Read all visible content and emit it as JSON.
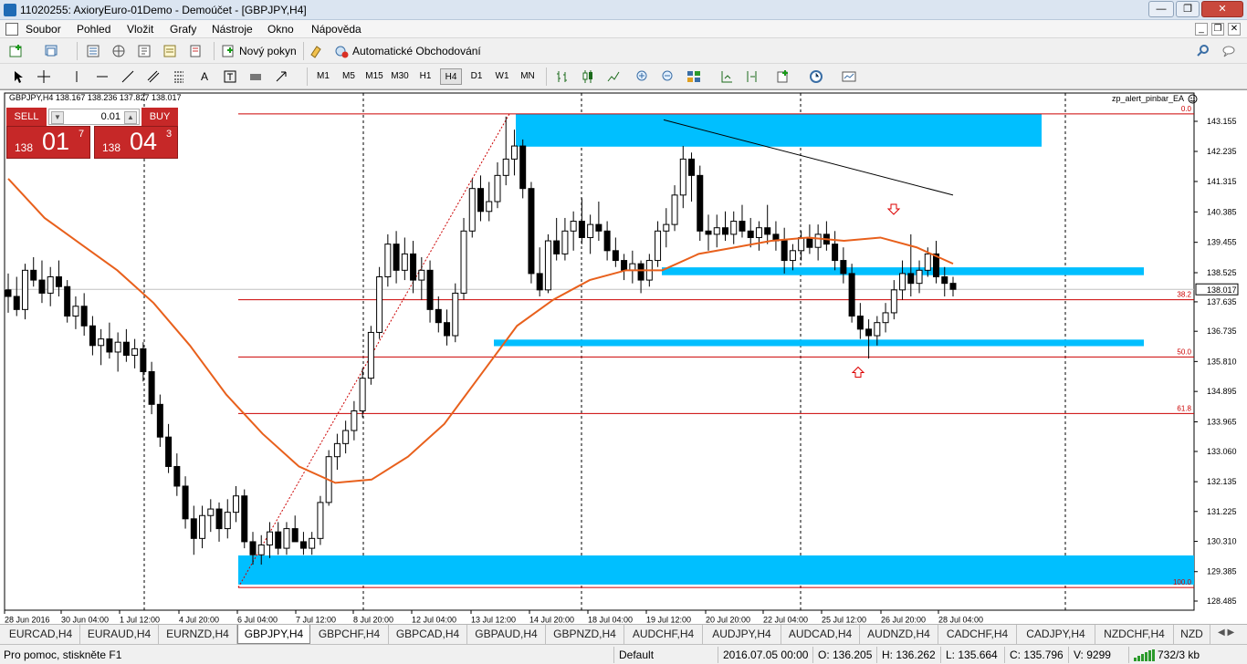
{
  "window": {
    "title": "11020255: AxioryEuro-01Demo - Demoúčet - [GBPJPY,H4]",
    "min": "—",
    "max": "❐",
    "close": "✕"
  },
  "menu": [
    "Soubor",
    "Pohled",
    "Vložit",
    "Grafy",
    "Nástroje",
    "Okno",
    "Nápověda"
  ],
  "toolbar1": {
    "new_order": "Nový pokyn",
    "auto_trading": "Automatické Obchodování"
  },
  "timeframes": [
    "M1",
    "M5",
    "M15",
    "M30",
    "H1",
    "H4",
    "D1",
    "W1",
    "MN"
  ],
  "active_timeframe": "H4",
  "chart": {
    "symbol_label": "GBPJPY,H4  138.167 138.236 137.827 138.017",
    "indicator": "zp_alert_pinbar_EA",
    "trade_panel": {
      "sell": "SELL",
      "buy": "BUY",
      "lot": "0.01",
      "sell_price": {
        "prefix": "138",
        "big": "01",
        "sup": "7"
      },
      "buy_price": {
        "prefix": "138",
        "big": "04",
        "sup": "3"
      }
    },
    "price_ticks": [
      "143.155",
      "142.235",
      "141.315",
      "140.385",
      "139.455",
      "138.525",
      "137.635",
      "136.735",
      "135.810",
      "134.895",
      "133.965",
      "133.060",
      "132.135",
      "131.225",
      "130.310",
      "129.385",
      "128.485"
    ],
    "current_price": "138.017",
    "time_ticks": [
      "28 Jun 2016",
      "30 Jun 04:00",
      "1 Jul 12:00",
      "4 Jul 20:00",
      "6 Jul 04:00",
      "7 Jul 12:00",
      "8 Jul 20:00",
      "12 Jul 04:00",
      "13 Jul 12:00",
      "14 Jul 20:00",
      "18 Jul 04:00",
      "19 Jul 12:00",
      "20 Jul 20:00",
      "22 Jul 04:00",
      "25 Jul 12:00",
      "26 Jul 20:00",
      "28 Jul 04:00"
    ],
    "fibo_levels": [
      {
        "label": "0.0",
        "price": 143.38
      },
      {
        "label": "38.2",
        "price": 137.7
      },
      {
        "label": "50.0",
        "price": 135.95
      },
      {
        "label": "61.8",
        "price": 134.22
      },
      {
        "label": "100.0",
        "price": 128.9
      }
    ],
    "colors": {
      "candle": "#000000",
      "ma": "#e8601c",
      "zone": "#00bfff",
      "fibo": "#cc0000",
      "sell_buy_bg": "#c62828"
    }
  },
  "chart_data": {
    "type": "candlestick",
    "symbol": "GBPJPY",
    "timeframe": "H4",
    "ylim": [
      128.485,
      143.155
    ],
    "ohlc": [
      [
        138.0,
        138.5,
        137.3,
        137.8
      ],
      [
        137.8,
        138.4,
        137.2,
        137.4
      ],
      [
        137.4,
        138.8,
        137.1,
        138.6
      ],
      [
        138.6,
        139.0,
        138.1,
        138.3
      ],
      [
        138.3,
        138.9,
        137.6,
        137.9
      ],
      [
        137.9,
        138.7,
        137.5,
        138.4
      ],
      [
        138.4,
        138.9,
        137.8,
        138.1
      ],
      [
        138.1,
        138.3,
        137.0,
        137.2
      ],
      [
        137.2,
        137.8,
        136.8,
        137.5
      ],
      [
        137.5,
        137.9,
        136.6,
        136.9
      ],
      [
        136.9,
        137.2,
        136.0,
        136.3
      ],
      [
        136.3,
        136.8,
        135.7,
        136.5
      ],
      [
        136.5,
        137.0,
        135.9,
        136.1
      ],
      [
        136.1,
        136.7,
        135.5,
        136.4
      ],
      [
        136.4,
        136.8,
        135.8,
        136.0
      ],
      [
        136.0,
        136.5,
        135.6,
        136.2
      ],
      [
        136.2,
        136.4,
        135.2,
        135.5
      ],
      [
        135.5,
        135.8,
        134.2,
        134.5
      ],
      [
        134.5,
        134.8,
        133.2,
        133.5
      ],
      [
        133.5,
        133.9,
        132.4,
        132.6
      ],
      [
        132.6,
        133.0,
        131.7,
        132.0
      ],
      [
        132.0,
        132.3,
        130.7,
        131.0
      ],
      [
        131.0,
        131.4,
        129.9,
        130.4
      ],
      [
        130.4,
        131.4,
        130.1,
        131.1
      ],
      [
        131.1,
        131.6,
        130.6,
        131.3
      ],
      [
        131.3,
        131.5,
        130.3,
        130.7
      ],
      [
        130.7,
        131.6,
        130.4,
        131.2
      ],
      [
        131.2,
        132.0,
        130.9,
        131.7
      ],
      [
        131.7,
        131.9,
        130.1,
        130.3
      ],
      [
        130.3,
        130.6,
        129.6,
        129.9
      ],
      [
        129.9,
        130.5,
        129.6,
        130.2
      ],
      [
        130.2,
        130.9,
        129.8,
        130.6
      ],
      [
        130.6,
        130.9,
        129.9,
        130.1
      ],
      [
        130.1,
        130.9,
        129.9,
        130.7
      ],
      [
        130.7,
        131.1,
        130.4,
        130.3
      ],
      [
        130.3,
        130.6,
        129.9,
        130.1
      ],
      [
        130.1,
        130.6,
        129.9,
        130.4
      ],
      [
        130.4,
        131.7,
        130.2,
        131.5
      ],
      [
        131.5,
        133.1,
        131.4,
        132.9
      ],
      [
        132.9,
        133.6,
        132.5,
        133.3
      ],
      [
        133.3,
        134.0,
        133.0,
        133.7
      ],
      [
        133.7,
        134.6,
        133.4,
        134.3
      ],
      [
        134.3,
        135.6,
        134.1,
        135.3
      ],
      [
        135.3,
        136.9,
        135.1,
        136.7
      ],
      [
        136.7,
        138.7,
        136.5,
        138.4
      ],
      [
        138.4,
        139.7,
        138.1,
        139.4
      ],
      [
        139.4,
        139.8,
        138.2,
        138.6
      ],
      [
        138.6,
        139.6,
        138.3,
        139.1
      ],
      [
        139.1,
        139.5,
        137.9,
        138.3
      ],
      [
        138.3,
        139.0,
        137.7,
        138.6
      ],
      [
        138.6,
        138.9,
        137.0,
        137.4
      ],
      [
        137.4,
        137.8,
        136.7,
        137.0
      ],
      [
        137.0,
        137.4,
        136.3,
        136.6
      ],
      [
        136.6,
        138.2,
        136.4,
        137.9
      ],
      [
        137.9,
        140.2,
        137.7,
        139.8
      ],
      [
        139.8,
        141.4,
        139.6,
        141.1
      ],
      [
        141.1,
        141.5,
        140.1,
        140.4
      ],
      [
        140.4,
        141.3,
        140.1,
        140.7
      ],
      [
        140.7,
        141.9,
        140.5,
        141.5
      ],
      [
        141.5,
        143.3,
        141.2,
        142.0
      ],
      [
        142.0,
        142.9,
        141.5,
        142.4
      ],
      [
        142.4,
        142.6,
        140.8,
        141.1
      ],
      [
        141.1,
        141.3,
        138.2,
        138.5
      ],
      [
        138.5,
        139.3,
        137.8,
        138.0
      ],
      [
        138.0,
        139.7,
        137.9,
        139.5
      ],
      [
        139.5,
        140.2,
        138.9,
        139.1
      ],
      [
        139.1,
        140.2,
        138.9,
        139.8
      ],
      [
        139.8,
        140.4,
        139.2,
        140.1
      ],
      [
        140.1,
        140.8,
        139.4,
        139.6
      ],
      [
        139.6,
        140.3,
        139.1,
        140.0
      ],
      [
        140.0,
        140.7,
        139.5,
        139.8
      ],
      [
        139.8,
        140.1,
        138.9,
        139.2
      ],
      [
        139.2,
        139.6,
        138.7,
        138.9
      ],
      [
        138.9,
        139.1,
        138.3,
        138.6
      ],
      [
        138.6,
        139.2,
        138.2,
        138.8
      ],
      [
        138.8,
        138.9,
        137.9,
        138.3
      ],
      [
        138.3,
        139.1,
        138.1,
        138.9
      ],
      [
        138.9,
        140.1,
        138.7,
        139.8
      ],
      [
        139.8,
        140.5,
        139.3,
        140.0
      ],
      [
        140.0,
        141.2,
        139.8,
        140.9
      ],
      [
        140.9,
        142.4,
        140.5,
        142.0
      ],
      [
        142.0,
        142.2,
        140.7,
        141.5
      ],
      [
        141.5,
        141.8,
        139.5,
        139.8
      ],
      [
        139.8,
        140.3,
        139.2,
        139.7
      ],
      [
        139.7,
        140.3,
        139.3,
        139.9
      ],
      [
        139.9,
        140.4,
        139.5,
        139.7
      ],
      [
        139.7,
        140.4,
        139.4,
        140.1
      ],
      [
        140.1,
        140.6,
        139.6,
        139.8
      ],
      [
        139.8,
        140.2,
        139.3,
        139.6
      ],
      [
        139.6,
        140.1,
        139.2,
        139.9
      ],
      [
        139.9,
        140.6,
        139.4,
        139.7
      ],
      [
        139.7,
        140.1,
        139.2,
        139.5
      ],
      [
        139.5,
        139.9,
        138.5,
        138.9
      ],
      [
        138.9,
        139.4,
        138.6,
        139.2
      ],
      [
        139.2,
        139.8,
        138.9,
        139.6
      ],
      [
        139.6,
        140.0,
        139.1,
        139.3
      ],
      [
        139.3,
        140.0,
        138.9,
        139.7
      ],
      [
        139.7,
        140.1,
        139.2,
        139.4
      ],
      [
        139.4,
        139.8,
        138.6,
        138.9
      ],
      [
        138.9,
        139.3,
        138.2,
        138.5
      ],
      [
        138.5,
        138.8,
        137.0,
        137.2
      ],
      [
        137.2,
        137.6,
        136.5,
        136.8
      ],
      [
        136.8,
        137.1,
        135.9,
        136.6
      ],
      [
        136.6,
        137.2,
        136.3,
        137.0
      ],
      [
        137.0,
        137.6,
        136.7,
        137.3
      ],
      [
        137.3,
        138.3,
        137.1,
        138.0
      ],
      [
        138.0,
        138.9,
        137.7,
        138.5
      ],
      [
        138.5,
        139.7,
        137.8,
        138.2
      ],
      [
        138.2,
        138.9,
        137.9,
        138.6
      ],
      [
        138.6,
        139.3,
        138.4,
        139.1
      ],
      [
        139.1,
        139.5,
        138.2,
        138.4
      ],
      [
        138.4,
        138.7,
        137.8,
        138.2
      ],
      [
        138.2,
        138.4,
        137.8,
        138.017
      ]
    ],
    "moving_average": [
      {
        "price": 141.4
      },
      {
        "price": 140.2
      },
      {
        "price": 139.4
      },
      {
        "price": 138.6
      },
      {
        "price": 137.6
      },
      {
        "price": 136.3
      },
      {
        "price": 134.8
      },
      {
        "price": 133.6
      },
      {
        "price": 132.6
      },
      {
        "price": 132.1
      },
      {
        "price": 132.2
      },
      {
        "price": 132.9
      },
      {
        "price": 133.9
      },
      {
        "price": 135.4
      },
      {
        "price": 136.9
      },
      {
        "price": 137.7
      },
      {
        "price": 138.3
      },
      {
        "price": 138.6
      },
      {
        "price": 138.6
      },
      {
        "price": 139.1
      },
      {
        "price": 139.3
      },
      {
        "price": 139.5
      },
      {
        "price": 139.6
      },
      {
        "price": 139.5
      },
      {
        "price": 139.6
      },
      {
        "price": 139.3
      },
      {
        "price": 138.8
      }
    ],
    "trendline": [
      {
        "price": 143.2
      },
      {
        "price": 140.9
      }
    ],
    "zones": [
      {
        "price_top": 143.38,
        "price_bottom": 142.38
      },
      {
        "price_top": 138.69,
        "price_bottom": 138.45
      },
      {
        "price_top": 136.48,
        "price_bottom": 136.28
      },
      {
        "price_top": 129.88,
        "price_bottom": 128.99
      }
    ],
    "pinbar_arrows": [
      {
        "dir": "down",
        "price": 140.45
      },
      {
        "dir": "up",
        "price": 135.5
      }
    ]
  },
  "tabs": [
    "EURCAD,H4",
    "EURAUD,H4",
    "EURNZD,H4",
    "GBPJPY,H4",
    "GBPCHF,H4",
    "GBPCAD,H4",
    "GBPAUD,H4",
    "GBPNZD,H4",
    "AUDCHF,H4",
    "AUDJPY,H4",
    "AUDCAD,H4",
    "AUDNZD,H4",
    "CADCHF,H4",
    "CADJPY,H4",
    "NZDCHF,H4",
    "NZD"
  ],
  "active_tab": "GBPJPY,H4",
  "status": {
    "help": "Pro pomoc, stiskněte F1",
    "profile": "Default",
    "datetime": "2016.07.05 00:00",
    "open": "O: 136.205",
    "high": "H: 136.262",
    "low": "L: 135.664",
    "close": "C: 135.796",
    "volume": "V: 9299",
    "traffic": "732/3 kb"
  }
}
